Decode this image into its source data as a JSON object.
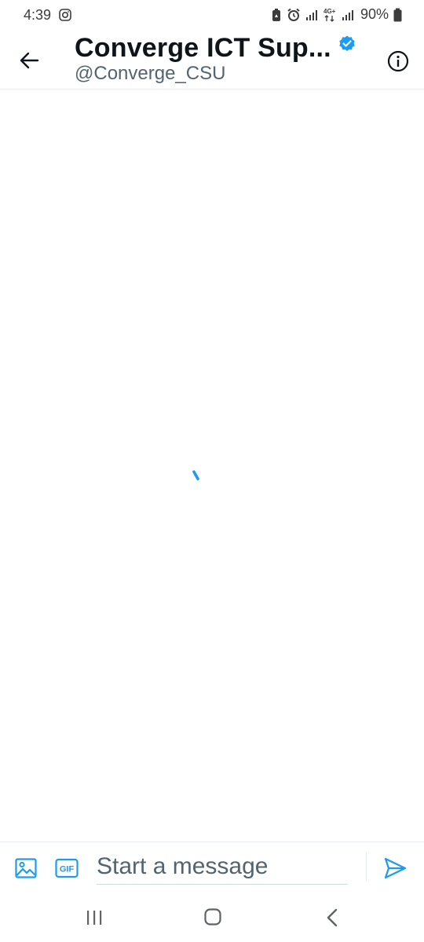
{
  "status_bar": {
    "time": "4:39",
    "network": "4G+",
    "battery": "90%"
  },
  "header": {
    "title": "Converge ICT Sup...",
    "handle": "@Converge_CSU",
    "verified": true
  },
  "composer": {
    "placeholder": "Start a message"
  },
  "icons": {
    "back": "arrow-left-icon",
    "info": "info-icon",
    "media": "image-icon",
    "gif": "gif-icon",
    "send": "send-icon"
  },
  "colors": {
    "accent": "#1d9bf0",
    "text_primary": "#0f1419",
    "text_secondary": "#536471"
  }
}
